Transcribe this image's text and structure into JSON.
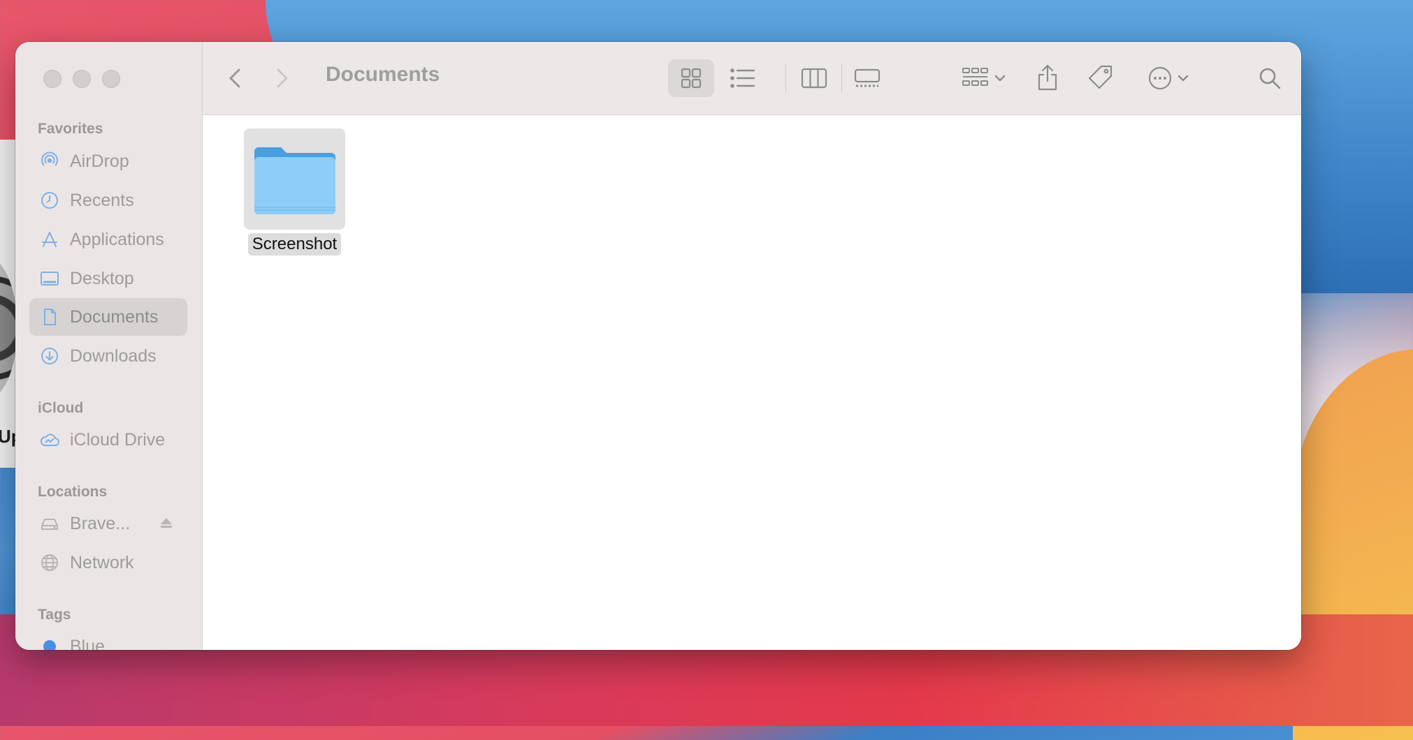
{
  "window_title": "Documents",
  "sidebar": {
    "sections": [
      {
        "header": "Favorites",
        "items": [
          {
            "label": "AirDrop",
            "icon": "airdrop-icon"
          },
          {
            "label": "Recents",
            "icon": "clock-icon"
          },
          {
            "label": "Applications",
            "icon": "applications-icon"
          },
          {
            "label": "Desktop",
            "icon": "desktop-icon"
          },
          {
            "label": "Documents",
            "icon": "document-icon",
            "selected": true
          },
          {
            "label": "Downloads",
            "icon": "download-icon"
          }
        ]
      },
      {
        "header": "iCloud",
        "items": [
          {
            "label": "iCloud Drive",
            "icon": "icloud-icon"
          }
        ]
      },
      {
        "header": "Locations",
        "items": [
          {
            "label": "Brave...",
            "icon": "disk-icon",
            "eject": true
          },
          {
            "label": "Network",
            "icon": "globe-icon"
          }
        ]
      },
      {
        "header": "Tags",
        "items": [
          {
            "label": "Blue",
            "icon": "tag-dot-icon",
            "color": "#4a90e2"
          }
        ]
      }
    ]
  },
  "files": [
    {
      "name": "Screenshot",
      "type": "folder",
      "icon": "folder-icon",
      "selected": true
    }
  ],
  "background": {
    "partial_text": "Up"
  },
  "colors": {
    "accent": "#4a9fe6",
    "folder": "#8ecdf7",
    "sidebar_icon": "#7cb0e6"
  }
}
